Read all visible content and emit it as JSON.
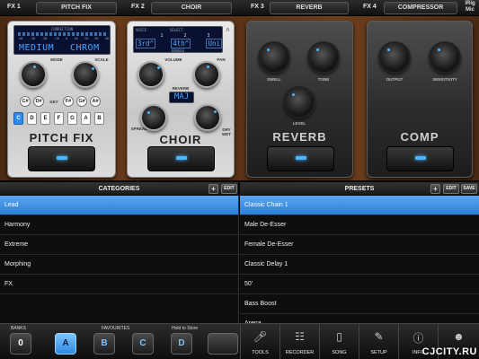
{
  "fx_bar": {
    "slots": [
      {
        "label": "FX 1",
        "name": "PITCH FIX"
      },
      {
        "label": "FX 2",
        "name": "CHOIR"
      },
      {
        "label": "FX 3",
        "name": "REVERB"
      },
      {
        "label": "FX 4",
        "name": "COMPRESSOR"
      }
    ],
    "irig": "iRig Mic"
  },
  "pedals": {
    "pitch_fix": {
      "name": "PITCH FIX",
      "correction_label": "CORRECTION",
      "scale_ticks": [
        "-40",
        "-30",
        "-20",
        "-10",
        "0",
        "10",
        "20",
        "30",
        "40"
      ],
      "lcd_left": "MEDIUM",
      "lcd_right": "CHROM",
      "knob1_label": "MODE",
      "knob2_label": "SCALE",
      "key_label": "KEY",
      "sharp_keys": [
        "C#",
        "D#",
        "F#",
        "G#",
        "A#"
      ],
      "natural_keys": [
        "C",
        "D",
        "E",
        "F",
        "G",
        "A",
        "B"
      ],
      "selected_key": "C"
    },
    "choir": {
      "name": "CHOIR",
      "voice_label": "VOICE",
      "select_label": "SELECT",
      "enable_label": "ENABLE",
      "voices": [
        "1",
        "2",
        "3"
      ],
      "intervals": [
        "3rd^",
        "4th^",
        "Uni"
      ],
      "volume_label": "VOLUME",
      "pan_label": "PAN",
      "reverb_label": "REVERB",
      "lcd_mode": "MAJ",
      "spread_label": "SPREAD",
      "drywet_label": "DRY WET"
    },
    "reverb": {
      "name": "REVERB",
      "swell_label": "SWELL",
      "tone_label": "TONE",
      "level_label": "LEVEL"
    },
    "comp": {
      "name": "COMP",
      "output_label": "OUTPUT",
      "sensitivity_label": "SENSITIVITY"
    }
  },
  "categories": {
    "title": "CATEGORIES",
    "add": "+",
    "edit": "EDIT",
    "items": [
      "Lead",
      "Harmony",
      "Extreme",
      "Morphing",
      "FX"
    ],
    "selected": "Lead"
  },
  "presets": {
    "title": "PRESETS",
    "add": "+",
    "edit": "EDIT",
    "save": "SAVE",
    "items": [
      "Classic Chain 1",
      "Male De-Esser",
      "Female De-Esser",
      "Classic Delay 1",
      "50'",
      "Bass Boost",
      "Arena"
    ],
    "selected": "Classic Chain 1"
  },
  "bottom": {
    "banks_label": "BANKS",
    "bank_value": "0",
    "favourites_label": "FAVOURITES",
    "hold_label": "Hold to Store",
    "favourites": [
      "A",
      "B",
      "C",
      "D"
    ],
    "active_favourite": "A",
    "tools": [
      "TOOLS",
      "RECORDER",
      "SONG",
      "SETUP",
      "INFO"
    ]
  },
  "watermark": "CJCITY.RU"
}
